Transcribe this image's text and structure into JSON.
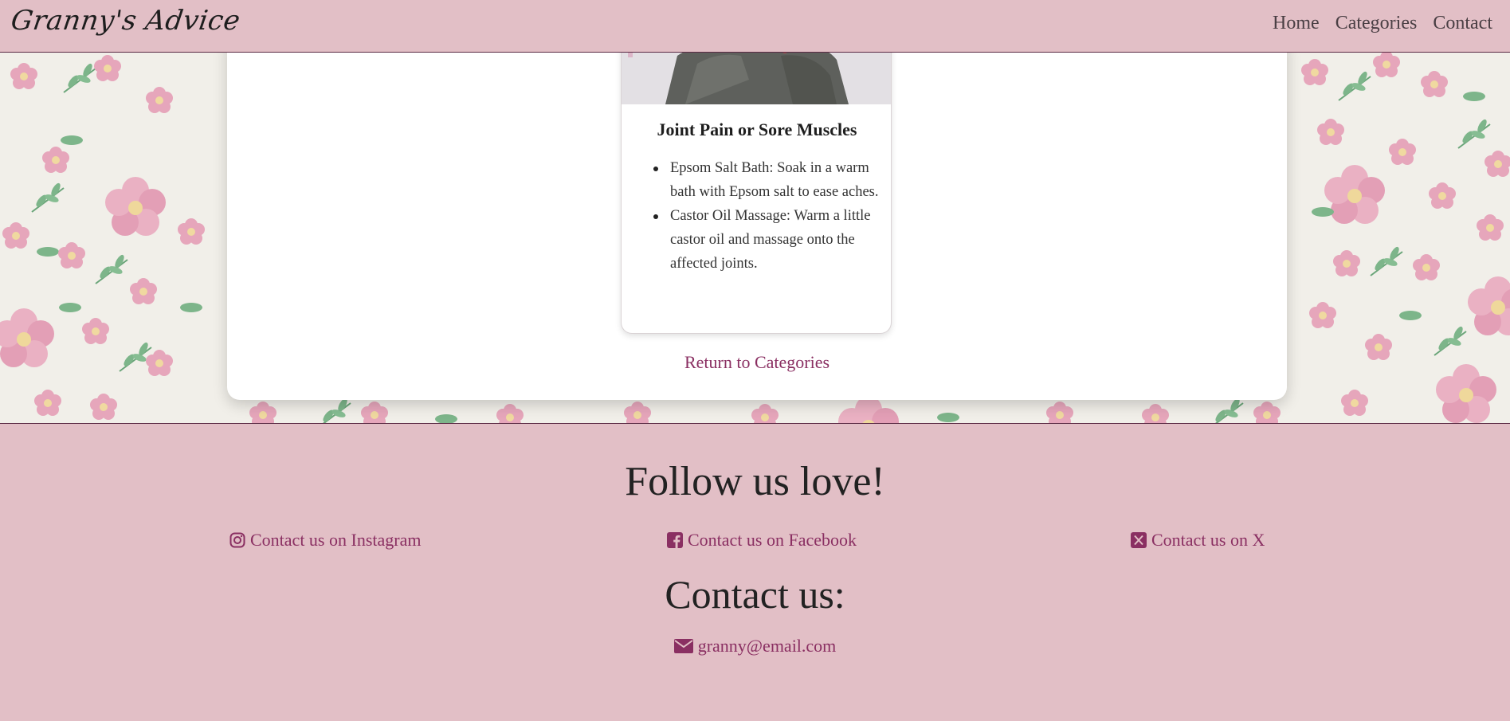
{
  "navbar": {
    "brand": "Granny's Advice",
    "links": [
      "Home",
      "Categories",
      "Contact"
    ]
  },
  "remedy": {
    "title": "Joint Pain or Sore Muscles",
    "items": [
      "Epsom Salt Bath: Soak in a warm bath with Epsom salt to ease aches.",
      "Castor Oil Massage: Warm a little castor oil and massage onto the affected joints."
    ]
  },
  "return_link": "Return to Categories",
  "footer": {
    "follow_heading": "Follow us love!",
    "social": {
      "instagram": "Contact us on Instagram",
      "facebook": "Contact us on Facebook",
      "x": "Contact us on X"
    },
    "contact_heading": "Contact us:",
    "email": "granny@email.com"
  },
  "icons": {
    "instagram": "instagram-icon",
    "facebook": "facebook-icon",
    "x": "x-icon",
    "email": "envelope-icon"
  },
  "colors": {
    "nav_bg": "#e2bfc6",
    "accent": "#8a2f62",
    "footer_bg": "#e2bfc6"
  }
}
